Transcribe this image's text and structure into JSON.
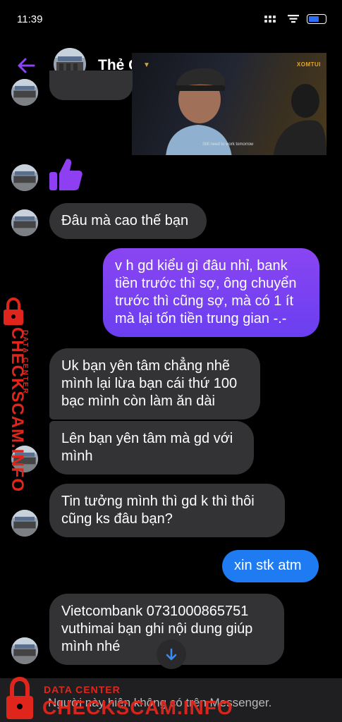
{
  "status_bar": {
    "time": "11:39"
  },
  "header": {
    "title": "Thẻ C"
  },
  "video": {
    "logo_left": "▼",
    "logo_right": "XOMTUI",
    "subtitle": "Still need to work tomorrow"
  },
  "messages": [
    {
      "from": "them",
      "lines": [
        "Đâu mà cao thế bạn"
      ]
    },
    {
      "from": "me",
      "lines": [
        "v h gd kiểu gì đâu nhỉ, bank",
        "tiền trước thì sợ, ông chuyển",
        "trước thì cũng sợ, mà có 1 ít",
        "mà lại tốn tiền trung gian -.-"
      ]
    },
    {
      "from": "them",
      "lines": [
        "Uk bạn yên tâm chẳng nhẽ",
        "mình lại lừa bạn cái thứ 100",
        "bạc mình còn làm ăn dài"
      ]
    },
    {
      "from": "them",
      "lines": [
        "Lên bạn yên tâm mà gd với",
        "mình"
      ]
    },
    {
      "from": "them",
      "lines": [
        "Tin tưởng mình thì gd k thì thôi",
        "cũng ks đâu bạn?"
      ]
    },
    {
      "from": "me",
      "lines": [
        "xin stk atm"
      ]
    },
    {
      "from": "them",
      "lines": [
        "Vietcombank 0731000865751",
        "vuthimai bạn ghi nội dung giúp",
        "mình nhé"
      ]
    }
  ],
  "composer": {
    "notice": "Người này hiện không có trên Messenger."
  },
  "watermark": {
    "title": "CHECKSCAM.INFO",
    "subtitle": "DATA CENTER"
  },
  "colors": {
    "accent": "#7b3ff2",
    "outgoing_blue": "#1f7bf2",
    "incoming": "#333335",
    "watermark": "#e0261c"
  },
  "icons": {
    "back": "arrow-left-icon",
    "like": "thumbs-up-icon",
    "scroll": "arrow-down-icon"
  }
}
